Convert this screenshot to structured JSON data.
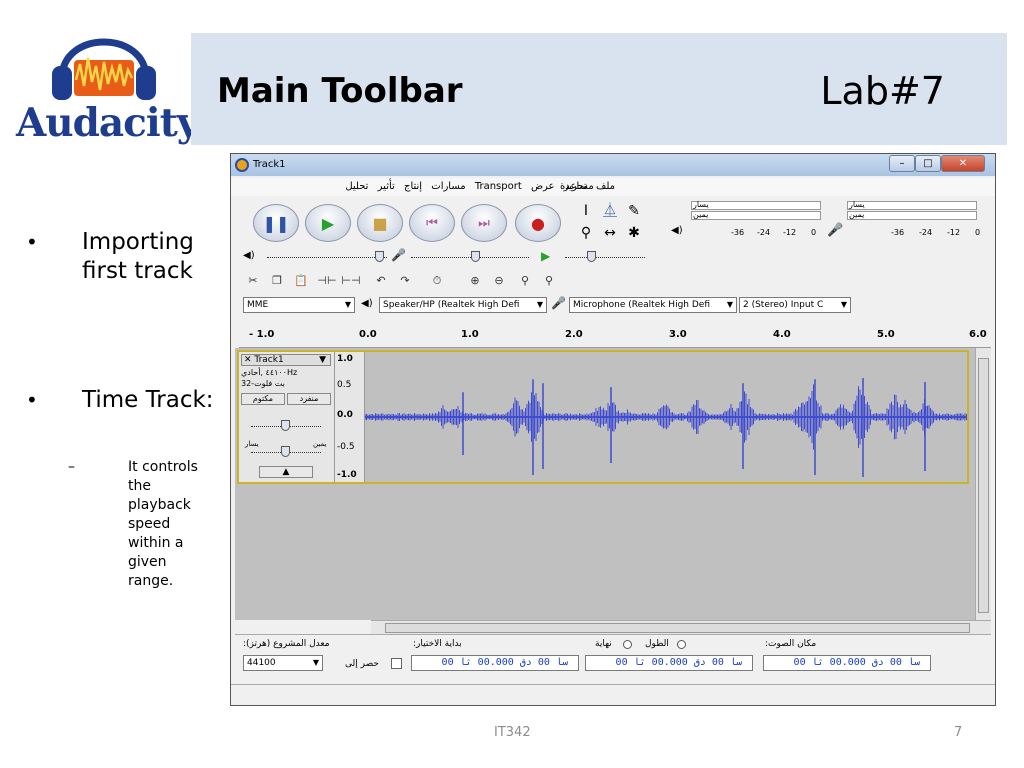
{
  "slide": {
    "logo_text": "Audacity",
    "title": "Main Toolbar",
    "lab": "Lab#7",
    "bullets": [
      {
        "text": "Importing first track"
      },
      {
        "text": "Time Track:"
      }
    ],
    "sub_bullet": "It controls the playback speed within a given range.",
    "footer_center": "IT342",
    "page_number": "7",
    "bullet_glyph": "•",
    "dash_glyph": "–"
  },
  "window": {
    "title": "Track1",
    "menu_rtl": [
      "ملف",
      "تحرير",
      "عرض",
      "Transport",
      "مسارات",
      "إنتاج",
      "تأثير",
      "تحليل"
    ],
    "menu_help": "مساعدة"
  },
  "meters": {
    "play_left": "يسار",
    "play_right": "يمين",
    "rec_left": "يسار",
    "rec_right": "يمين",
    "ticks_play": [
      "-36",
      "-24",
      "-12",
      "0"
    ],
    "ticks_rec": [
      "-36",
      "-24",
      "-12",
      "0"
    ]
  },
  "devices": {
    "host": "MME",
    "output": "Speaker/HP (Realtek High Defi",
    "input": "Microphone (Realtek High Defi",
    "channels": "2 (Stereo) Input C"
  },
  "ruler": {
    "labels": [
      "- 1.0",
      "0.0",
      "1.0",
      "2.0",
      "3.0",
      "4.0",
      "5.0",
      "6.0"
    ]
  },
  "track": {
    "name": "Track1",
    "rate": "٤٤١٠٠ ,أحادي‎Hz",
    "format": "32-بت فلوت",
    "mute": "مكتوم",
    "solo": "منفرد",
    "pan_left": "يسار",
    "pan_right": "يمين",
    "scale": [
      "1.0",
      "0.5",
      "0.0",
      "-0.5",
      "-1.0"
    ],
    "wave_color": "#3f4ccf"
  },
  "selection_bar": {
    "project_rate_label": ":(معدل المشروع (هرتز",
    "project_rate": "44100",
    "snap_to": "حصر إلى",
    "selection_start_label": ":بداية الاختيار",
    "end_label": "نهاية",
    "length_label": "الطول",
    "audio_position_label": ":مكان الصوت",
    "start_time": "00 سا 00 دق 00.000 ثا",
    "end_time": "00 سا 00 دق 00.000 ثا",
    "position_time": "00 سا 00 دق 00.000 ثا"
  },
  "icons": {
    "pause": "❚❚",
    "play": "▶",
    "stop": "■",
    "skip_start": "⏮",
    "skip_end": "⏭",
    "record": "●",
    "speaker": "◀)",
    "microphone": "🎤",
    "dropdown": "▼",
    "close": "✕",
    "maximize": "□",
    "minimize": "–"
  }
}
